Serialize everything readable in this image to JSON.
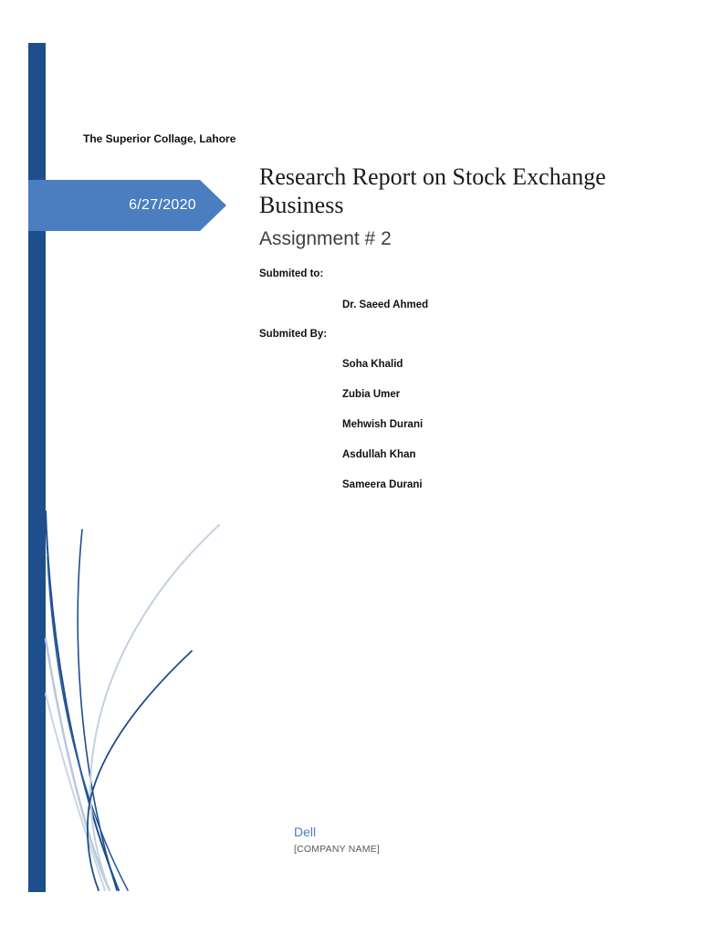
{
  "header": {
    "institution": "The Superior Collage, Lahore",
    "date": "6/27/2020"
  },
  "report": {
    "title": "Research Report on Stock Exchange Business",
    "subtitle": "Assignment # 2"
  },
  "submission": {
    "to_label": "Submited to:",
    "to_name": "Dr. Saeed Ahmed",
    "by_label": "Submited By:",
    "members": [
      "Soha Khalid",
      "Zubia Umer",
      "Mehwish Durani",
      "Asdullah Khan",
      "Sameera Durani"
    ]
  },
  "footer": {
    "company": "Dell",
    "company_placeholder": "[COMPANY NAME]"
  },
  "colors": {
    "sidebar": "#1f4e8c",
    "banner": "#4a7ec1",
    "accent_text": "#4a7ec1"
  }
}
